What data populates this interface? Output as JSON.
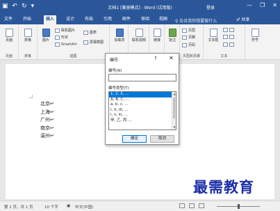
{
  "titlebar": {
    "qat_icons": [
      "save-icon",
      "undo-icon",
      "redo-icon",
      "customize-icon"
    ],
    "save_glyph": "▣",
    "undo_glyph": "↶",
    "redo_glyph": "↻",
    "customize_glyph": "▾",
    "title": "文档1 [兼容模式] - Word (试用版)",
    "login": "登录",
    "minimize": "—",
    "restore": "❐",
    "close": "✕"
  },
  "tabs": [
    {
      "label": "文件",
      "active": false
    },
    {
      "label": "开始",
      "active": false
    },
    {
      "label": "插入",
      "active": true
    },
    {
      "label": "设计",
      "active": false
    },
    {
      "label": "布局",
      "active": false
    },
    {
      "label": "引用",
      "active": false
    },
    {
      "label": "邮件",
      "active": false
    },
    {
      "label": "审阅",
      "active": false
    },
    {
      "label": "视图",
      "active": false
    }
  ],
  "tell_me": "♀ 告诉我你想要做什么",
  "share": "♂ 共享",
  "ribbon": {
    "groups": {
      "pages": "页面",
      "table": "表格",
      "illustrations": "插图",
      "header_footer": "页眉和页脚",
      "text": "文本"
    },
    "buttons": {
      "pages": "页面",
      "table": "表格",
      "picture": "图片",
      "online_picture": "联机图片",
      "shapes": "形状",
      "smartart": "SmartArt",
      "chart": "图表",
      "screenshot": "屏幕截图",
      "addins": "加载项",
      "online_video": "联机视频",
      "link": "链接",
      "comment": "批注",
      "header": "页眉",
      "footer": "页脚",
      "page_number": "页码",
      "textbox": "文本框",
      "symbol": "符号"
    }
  },
  "document": {
    "lines": [
      "北京↵",
      "上海↵",
      "广州↵",
      "南京↵",
      "温州↵"
    ]
  },
  "dialog": {
    "title": "编号",
    "help": "?",
    "close": "✕",
    "number_label": "编号(N)",
    "number_value": "",
    "type_label": "编号类型(T)",
    "types": [
      "1, 2, 3, ...",
      "A, B, C, ...",
      "a, b, c, ...",
      "I, II, III, ...",
      "i, ii, iii, ...",
      "甲, 乙, 丙 ..."
    ],
    "selected_type": "1, 2, 3, ...",
    "ok": "确定",
    "cancel": "取消"
  },
  "statusbar": {
    "page": "第 1 页，共 1 页",
    "words": "10 个字",
    "lang": "中文(中国)",
    "zoom_percent": 50
  },
  "watermark": "最需教育",
  "colors": {
    "accent": "#2b579a",
    "selection": "#0078d7",
    "watermark": "#1d2fa8"
  }
}
